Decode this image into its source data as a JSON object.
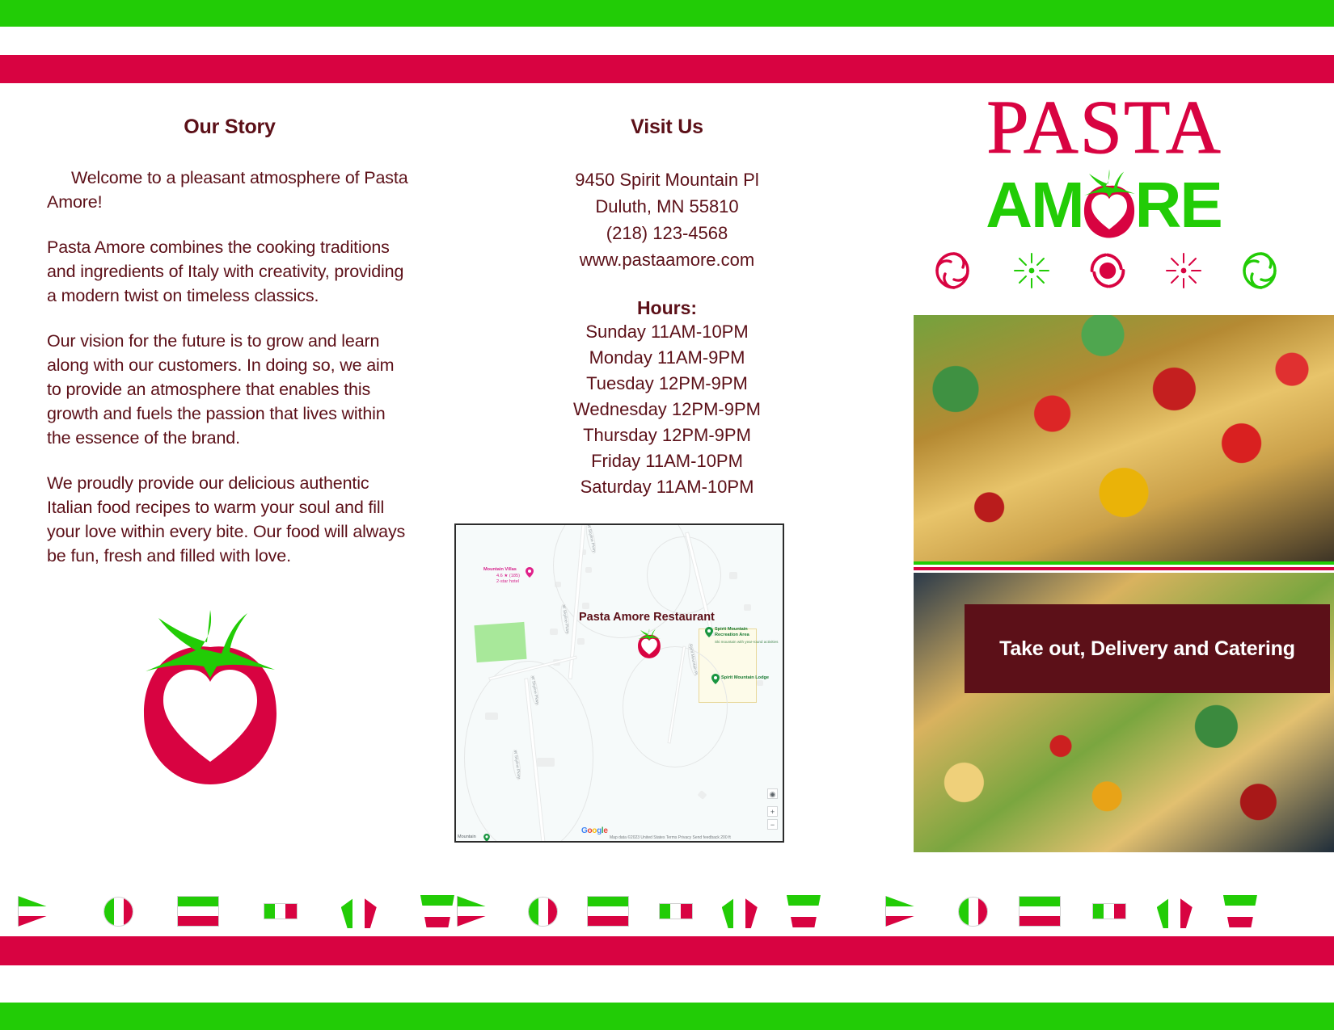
{
  "colors": {
    "crimson": "#d80341",
    "green": "#22cc06",
    "maroon": "#5c1018",
    "white": "#ffffff"
  },
  "story": {
    "heading": "Our Story",
    "paragraphs": [
      "Welcome to a pleasant atmosphere of Pasta Amore!",
      "Pasta Amore combines the cooking traditions and ingredients of Italy with creativity, providing a modern twist on timeless classics.",
      "Our vision for the future is to grow and learn along with our customers. In doing so, we aim to provide an atmosphere that enables this growth and fuels the passion that lives within the essence of the brand.",
      "We proudly provide our delicious authentic Italian food recipes to warm your soul and fill your love within every bite. Our food will always be fun, fresh and filled with love."
    ]
  },
  "visit": {
    "heading": "Visit Us",
    "address_line1": "9450 Spirit Mountain Pl",
    "address_line2": "Duluth, MN 55810",
    "phone": "(218) 123-4568",
    "website": "www.pastaamore.com",
    "hours_heading": "Hours:",
    "hours": [
      "Sunday 11AM-10PM",
      "Monday 11AM-9PM",
      "Tuesday 12PM-9PM",
      "Wednesday 12PM-9PM",
      "Thursday 12PM-9PM",
      "Friday 11AM-10PM",
      "Saturday 11AM-10PM"
    ]
  },
  "map": {
    "restaurant_label": "Pasta Amore Restaurant",
    "poi": [
      {
        "name": "Mountain Villas",
        "rating": "4.6 ★ (185)",
        "type": "2-star hotel"
      },
      {
        "name": "Spirit Mountain",
        "name2": "Recreation Area",
        "sub": "Ski mountain with year-round activities"
      },
      {
        "name": "Spirit Mountain Lodge"
      }
    ],
    "roads": [
      "W Skyline Pkwy",
      "W Skyline Pkwy",
      "W Skyline Pkwy",
      "W Skyline Pkwy",
      "Spirit Mountain Pl"
    ],
    "corner_label": "Mountain",
    "attribution": "Map data ©2023   United States   Terms   Privacy   Send feedback   200 ft",
    "google_letters": [
      "G",
      "o",
      "o",
      "g",
      "l",
      "e"
    ],
    "controls": {
      "locate": "◉",
      "zoom_in": "+",
      "zoom_out": "−"
    }
  },
  "cover": {
    "logo_top": "PASTA",
    "logo_bottom_left": "AM",
    "logo_bottom_right": "RE",
    "logo_icon_name": "tomato-heart-icon",
    "cta": "Take out, Delivery and Catering"
  },
  "decor": {
    "icons": [
      "spiral-outline-crimson",
      "starburst-green",
      "spiral-filled-crimson",
      "starburst-crimson",
      "spiral-outline-green"
    ]
  },
  "flags": {
    "shapes": [
      "arrow",
      "circle",
      "rect",
      "small-rect",
      "pentagon",
      "trapezoid"
    ]
  }
}
